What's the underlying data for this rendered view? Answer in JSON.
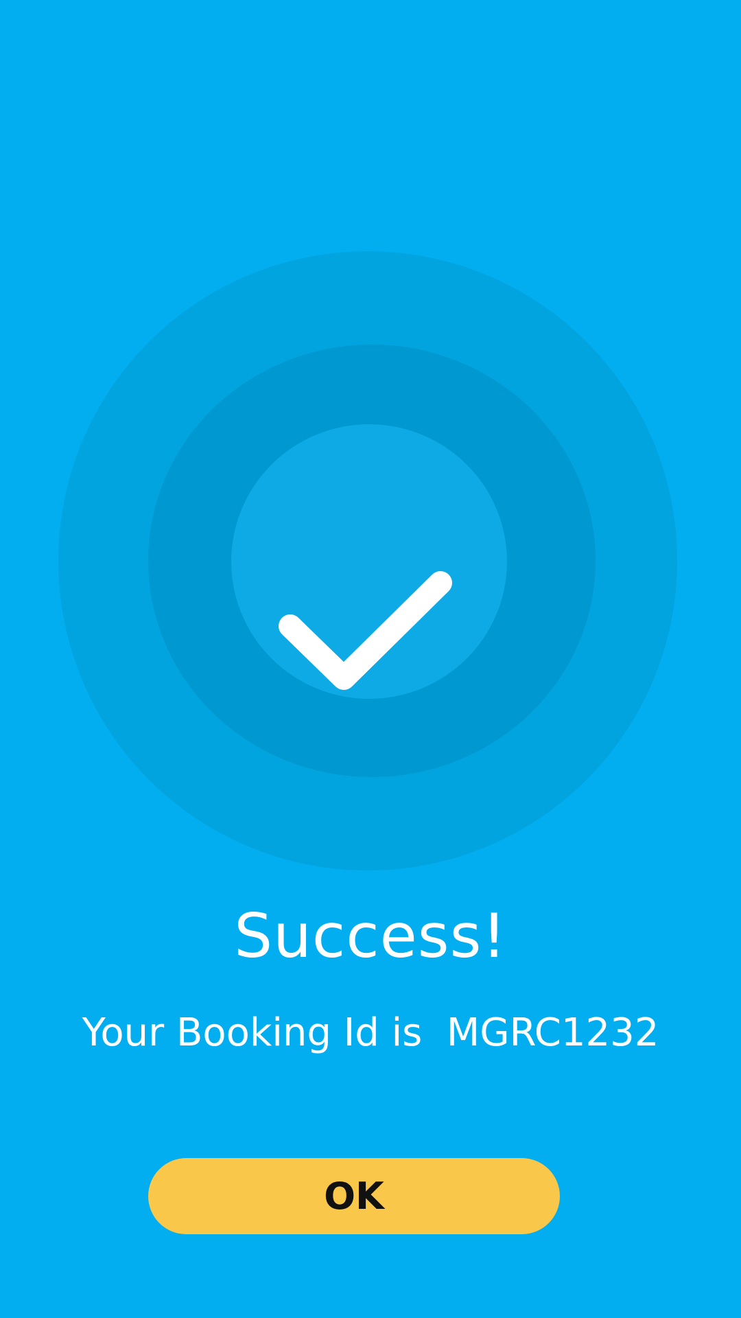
{
  "screen": {
    "background_color": "#02aeef",
    "success_icon": "check-mark-icon",
    "title": "Success!",
    "booking_message": "Your Booking Id is  MGRC1232",
    "ok_label": "OK"
  },
  "colors": {
    "outer_ring": "#01a4df",
    "middle_ring": "#0098d1",
    "inner_ring": "#0eaae6",
    "button": "#f9c74a",
    "button_text": "#111111",
    "text": "#ffffff"
  }
}
